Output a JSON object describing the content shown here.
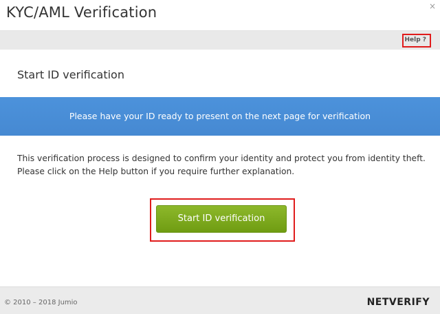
{
  "window": {
    "title": "KYC/AML Verification",
    "close_label": "×"
  },
  "help": {
    "label": "Help ?"
  },
  "main": {
    "heading": "Start ID verification",
    "banner_text": "Please have your ID ready to present on the next page for verification",
    "description": "This verification process is designed to confirm your identity and protect you from identity theft. Please click on the Help button if you require further explanation.",
    "start_button_label": "Start ID verification"
  },
  "footer": {
    "copyright": "© 2010 – 2018 Jumio",
    "brand": "NETVERIFY"
  },
  "colors": {
    "banner": "#4a90d9",
    "start_button": "#7fac1c",
    "highlight": "#e01b1b",
    "footer_bg": "#ebebeb"
  }
}
